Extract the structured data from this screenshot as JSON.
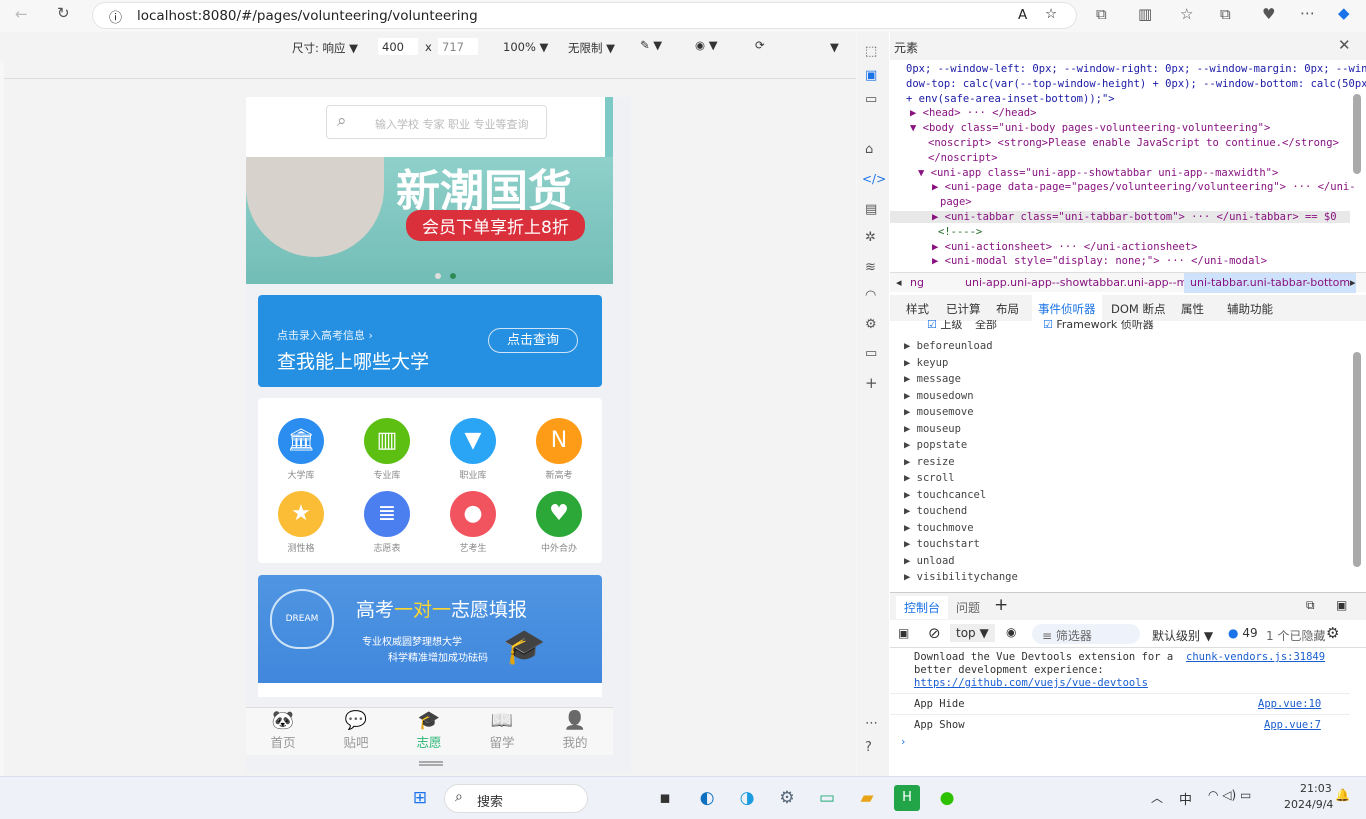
{
  "browser": {
    "url": "localhost:8080/#/pages/volunteering/volunteering"
  },
  "device_toolbar": {
    "size_label": "尺寸: 响应",
    "width": "400",
    "x": "x",
    "height": "717",
    "zoom": "100%",
    "throttle": "无限制"
  },
  "app": {
    "search_placeholder": "输入学校 专家 职业 专业等查询",
    "banner": {
      "title": "新潮国货",
      "subtitle": "会员下单享折上8折"
    },
    "query_card": {
      "hint": "点击录入高考信息",
      "title": "查我能上哪些大学",
      "button": "点击查询"
    },
    "grid": [
      {
        "label": "大学库",
        "icon": "bank-icon",
        "color": "#2b8df0"
      },
      {
        "label": "专业库",
        "icon": "books-icon",
        "color": "#5cbf12"
      },
      {
        "label": "职业库",
        "icon": "tie-icon",
        "color": "#2aa5f5"
      },
      {
        "label": "新高考",
        "icon": "n-note-icon",
        "color": "#ff9c17"
      },
      {
        "label": "测性格",
        "icon": "star-icon",
        "color": "#fbbd36"
      },
      {
        "label": "志愿表",
        "icon": "scroll-icon",
        "color": "#4b7ff0"
      },
      {
        "label": "艺考生",
        "icon": "palette-icon",
        "color": "#f2545f"
      },
      {
        "label": "中外合办",
        "icon": "handshake-icon",
        "color": "#2ba838"
      }
    ],
    "promo": {
      "title_a": "高考",
      "title_b": "一对一",
      "title_c": "志愿填报",
      "line1": "专业权威圆梦理想大学",
      "line2": "科学精准增加成功砝码",
      "balloon": "DREAM"
    },
    "tabbar": [
      {
        "label": "首页",
        "icon": "panda-icon"
      },
      {
        "label": "贴吧",
        "icon": "chat-icon"
      },
      {
        "label": "志愿",
        "icon": "graduation-cap-icon",
        "active": true
      },
      {
        "label": "留学",
        "icon": "book-icon"
      },
      {
        "label": "我的",
        "icon": "user-icon"
      }
    ],
    "accent": "#2bb673"
  },
  "devtools": {
    "title": "元素",
    "elements": [
      "0px; --window-left: 0px; --window-right: 0px; --window-margin: 0px; --win",
      "dow-top: calc(var(--top-window-height) + 0px); --window-bottom: calc(50px",
      "+ env(safe-area-inset-bottom));\">",
      "▶ <head> ··· </head>",
      "▼ <body class=\"uni-body pages-volunteering-volunteering\">",
      "<noscript> <strong>Please enable JavaScript to continue.</strong>",
      "</noscript>",
      "▼ <uni-app class=\"uni-app--showtabbar uni-app--maxwidth\">",
      "▶ <uni-page data-page=\"pages/volunteering/volunteering\"> ··· </uni-",
      "page>",
      "▶ <uni-tabbar class=\"uni-tabbar-bottom\"> ··· </uni-tabbar> == $0",
      "<!---->",
      "▶ <uni-actionsheet> ··· </uni-actionsheet>",
      "▶ <uni-modal style=\"display: none;\"> ··· </uni-modal>"
    ],
    "breadcrumb": [
      "ng",
      "uni-app.uni-app--showtabbar.uni-app--maxwidth",
      "uni-tabbar.uni-tabbar-bottom"
    ],
    "tabs": [
      "样式",
      "已计算",
      "布局",
      "事件侦听器",
      "DOM 断点",
      "属性",
      "辅助功能"
    ],
    "active_tab": "事件侦听器",
    "filter_row": {
      "ancestors": "上级",
      "scope": "全部",
      "framework": "Framework 侦听器"
    },
    "events": [
      "beforeunload",
      "keyup",
      "message",
      "mousedown",
      "mousemove",
      "mouseup",
      "popstate",
      "resize",
      "scroll",
      "touchcancel",
      "touchend",
      "touchmove",
      "touchstart",
      "unload",
      "visibilitychange"
    ],
    "drawer_tabs": [
      "控制台",
      "问题"
    ],
    "console_toolbar": {
      "context": "top",
      "filter_placeholder": "筛选器",
      "level": "默认级别",
      "count": "49",
      "hidden": "1 个已隐藏"
    },
    "messages": [
      {
        "text": "Download the Vue Devtools extension for a better development experience:",
        "link": "https://github.com/vuejs/vue-devtools",
        "source": "chunk-vendors.js:31849"
      },
      {
        "text": "App Hide",
        "source": "App.vue:10"
      },
      {
        "text": "App Show",
        "source": "App.vue:7"
      }
    ]
  },
  "taskbar": {
    "search": "搜索",
    "time": "21:03",
    "date": "2024/9/4",
    "ime": "中"
  }
}
